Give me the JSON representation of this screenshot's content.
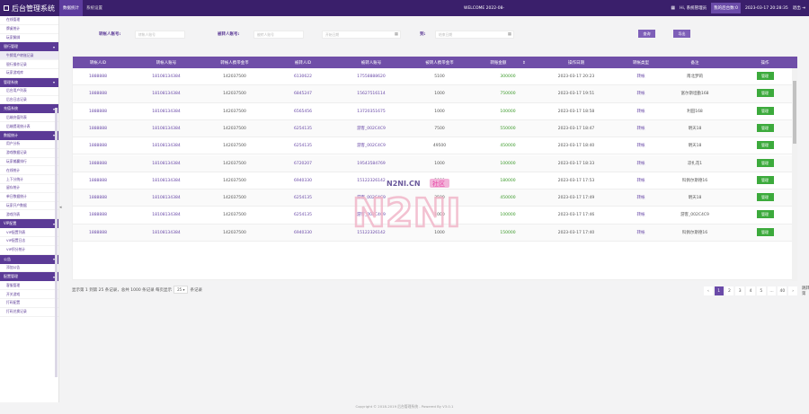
{
  "app": {
    "title": "后台管理系统",
    "welcome": "WELCOME 2022-08-",
    "user": "Hi, 系统管理员",
    "panel": "我的后台数:0",
    "datetime": "2023-03-17 20:28:35",
    "logout": "退出"
  },
  "nav": [
    {
      "label": "数据统计",
      "active": true
    },
    {
      "label": "系统设置",
      "active": false
    }
  ],
  "sidebar": [
    {
      "type": "item",
      "label": "在线管理"
    },
    {
      "type": "item",
      "label": "牌桌统计"
    },
    {
      "type": "item",
      "label": "玩家解绑"
    },
    {
      "type": "group",
      "label": "银行管理"
    },
    {
      "type": "item",
      "label": "牛牌用户转账记录",
      "selected": true
    },
    {
      "type": "item",
      "label": "银行操作记录"
    },
    {
      "type": "item",
      "label": "玩家游戏库"
    },
    {
      "type": "group",
      "label": "管理系统"
    },
    {
      "type": "item",
      "label": "后台用户列表"
    },
    {
      "type": "item",
      "label": "后台日志记录"
    },
    {
      "type": "group",
      "label": "充值系统"
    },
    {
      "type": "item",
      "label": "后端充值列表"
    },
    {
      "type": "item",
      "label": "后端提现统计表"
    },
    {
      "type": "group",
      "label": "数据统计"
    },
    {
      "type": "item",
      "label": "用户分析"
    },
    {
      "type": "item",
      "label": "游戏数据记录"
    },
    {
      "type": "item",
      "label": "玩家输赢排行"
    },
    {
      "type": "item",
      "label": "在线统计"
    },
    {
      "type": "item",
      "label": "上下分统计"
    },
    {
      "type": "item",
      "label": "留存统计"
    },
    {
      "type": "item",
      "label": "单日数据统计"
    },
    {
      "type": "item",
      "label": "玩家开户数据"
    },
    {
      "type": "item",
      "label": "游戏列表"
    },
    {
      "type": "group",
      "label": "VIP配置"
    },
    {
      "type": "item",
      "label": "VIP配置列表"
    },
    {
      "type": "item",
      "label": "VIP配置日志"
    },
    {
      "type": "item",
      "label": "VIP积分统计"
    },
    {
      "type": "group",
      "label": "公告"
    },
    {
      "type": "item",
      "label": "添加公告"
    },
    {
      "type": "group",
      "label": "配置管理"
    },
    {
      "type": "item",
      "label": "客服管理"
    },
    {
      "type": "item",
      "label": "开关游戏"
    },
    {
      "type": "item",
      "label": "打码配置"
    },
    {
      "type": "item",
      "label": "打码兑换记录"
    }
  ],
  "filters": {
    "from_label": "转帐人账号:",
    "from_ph": "转帐人账号",
    "to_label": "被转人账号:",
    "to_ph": "被转人账号",
    "date_from_ph": "开始日期",
    "to_sep": "到:",
    "date_to_ph": "结束日期",
    "query_btn": "查询",
    "export_btn": "导出"
  },
  "table": {
    "headers": [
      "转帐人ID",
      "转帐人账号",
      "转帐人携带金币",
      "被转人ID",
      "被转人账号",
      "被转人携带金币",
      "转账金额",
      "操作日期",
      "转帐类型",
      "备注",
      "操作"
    ],
    "sort_icon": "sort-icon",
    "rows": [
      [
        "1888888",
        "18108134384",
        "142037500",
        "6130622",
        "17558888620",
        "5100",
        "300000",
        "2023-03-17 20:23",
        "转帐",
        "南北梦莉",
        "管理"
      ],
      [
        "1888888",
        "18108134384",
        "142037500",
        "6845247",
        "15627516114",
        "1000",
        "750000",
        "2023-03-17 19:51",
        "转帐",
        "富尔斯坦勤168",
        "管理"
      ],
      [
        "1888888",
        "18108134384",
        "142037500",
        "6565456",
        "13720351675",
        "1000",
        "100000",
        "2023-03-17 18:58",
        "转帐",
        "利田168",
        "管理"
      ],
      [
        "1888888",
        "18108134384",
        "142037500",
        "6254135",
        "游客_002C4C9",
        "7500",
        "550000",
        "2023-03-17 18:47",
        "转帐",
        "明天18",
        "管理"
      ],
      [
        "1888888",
        "18108134384",
        "142037500",
        "6254135",
        "游客_002C4C9",
        "49500",
        "450000",
        "2023-03-17 18:40",
        "转帐",
        "明天18",
        "管理"
      ],
      [
        "1888888",
        "18108134384",
        "142037500",
        "6720207",
        "19543584769",
        "1000",
        "100000",
        "2023-03-17 18:33",
        "转帐",
        "凉扎花1",
        "管理"
      ],
      [
        "1888888",
        "18108134384",
        "142037500",
        "6940330",
        "15122326142",
        "2000",
        "180000",
        "2023-03-17 17:53",
        "转帐",
        "科佩尔斯德16",
        "管理"
      ],
      [
        "1888888",
        "18108134384",
        "142037500",
        "6254135",
        "游客_002C4C9",
        "3500",
        "450000",
        "2023-03-17 17:49",
        "转帐",
        "明天18",
        "管理"
      ],
      [
        "1888888",
        "18108134384",
        "142037500",
        "6254135",
        "游客_002C4C9",
        "1000",
        "100000",
        "2023-03-17 17:46",
        "转帐",
        "游客_002C4C9",
        "管理"
      ],
      [
        "1888888",
        "18108134384",
        "142037500",
        "6940330",
        "15122326142",
        "1000",
        "150000",
        "2023-03-17 17:40",
        "转帐",
        "科佩尔斯德16",
        "管理"
      ]
    ]
  },
  "pagination": {
    "info_pre": "显示第 1 到第 25 条记录，总共 1000 条记录 每页显示",
    "per_page": "25",
    "info_post": "条记录",
    "prev": "‹",
    "pages": [
      "1",
      "2",
      "3",
      "4",
      "5",
      "...",
      "40"
    ],
    "current": "1",
    "next": "›",
    "jump_label": "跳转到第",
    "jump_suffix": "页",
    "jump_btn": "跳转"
  },
  "watermark": {
    "site": "N2NI.CN",
    "tag": "社区",
    "logo": "N2NI"
  },
  "copyright": "Copyright © 2018-2019 后台管理系统 - Powered By V3.0.1",
  "colors": {
    "primary": "#3a1f6b",
    "accent": "#6f4ea8",
    "green": "#3c9a2b",
    "button": "#3caa3c"
  }
}
